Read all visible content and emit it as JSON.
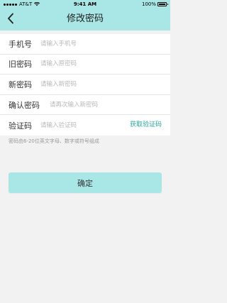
{
  "status_bar": {
    "carrier": "AT&T",
    "time": "9:41 AM",
    "battery": "100%"
  },
  "header": {
    "title": "修改密码",
    "back_icon": "chevron-left-icon"
  },
  "form": {
    "phone": {
      "label": "手机号",
      "placeholder": "请输入手机号",
      "value": ""
    },
    "old_password": {
      "label": "旧密码",
      "placeholder": "请输入原密码",
      "value": ""
    },
    "new_password": {
      "label": "新密码",
      "placeholder": "请输入新密码",
      "value": ""
    },
    "confirm_password": {
      "label": "确认密码",
      "placeholder": "请再次输入新密码",
      "value": ""
    },
    "verification_code": {
      "label": "验证码",
      "placeholder": "请输入验证码",
      "value": "",
      "get_code_label": "获取验证码"
    }
  },
  "hint": "密码由6-20位英文字母、数字或符号组成",
  "confirm_button": {
    "label": "确定"
  },
  "colors": {
    "accent": "#a9e7e7",
    "link": "#2aa9a0",
    "background": "#f2f2f2"
  }
}
